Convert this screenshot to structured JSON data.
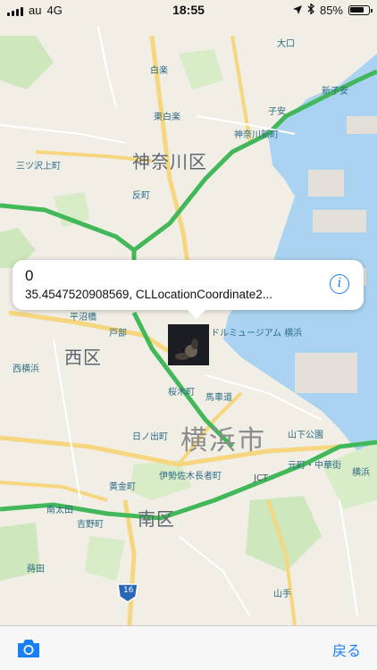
{
  "status_bar": {
    "carrier": "au",
    "network": "4G",
    "time": "18:55",
    "battery_percent": "85%",
    "battery_level": 0.85
  },
  "map": {
    "districts": [
      "神奈川区",
      "西区",
      "南区"
    ],
    "city": "横浜市",
    "places": [
      "東白楽",
      "反町",
      "神奈川新町",
      "子安",
      "新子安",
      "大口",
      "白楽",
      "三ツ沢上町",
      "平沼橋",
      "戸部",
      "西横浜",
      "桜木町",
      "馬車道",
      "日ノ出町",
      "伊勢佐木長者町",
      "黄金町",
      "南太田",
      "吉野町",
      "蒔田",
      "山下公園",
      "元町・中華街",
      "山手",
      "横浜",
      "ドルミュージアム 横浜",
      "JCT",
      "16"
    ]
  },
  "callout": {
    "title": "0",
    "subtitle": "35.4547520908569, CLLocationCoordinate2..."
  },
  "toolbar": {
    "back_label": "戻る"
  },
  "colors": {
    "accent": "#1a7ef5",
    "water": "#a9d3f0",
    "park": "#cfe7bd",
    "highway": "#43b85a",
    "major_road": "#f6d67e"
  }
}
